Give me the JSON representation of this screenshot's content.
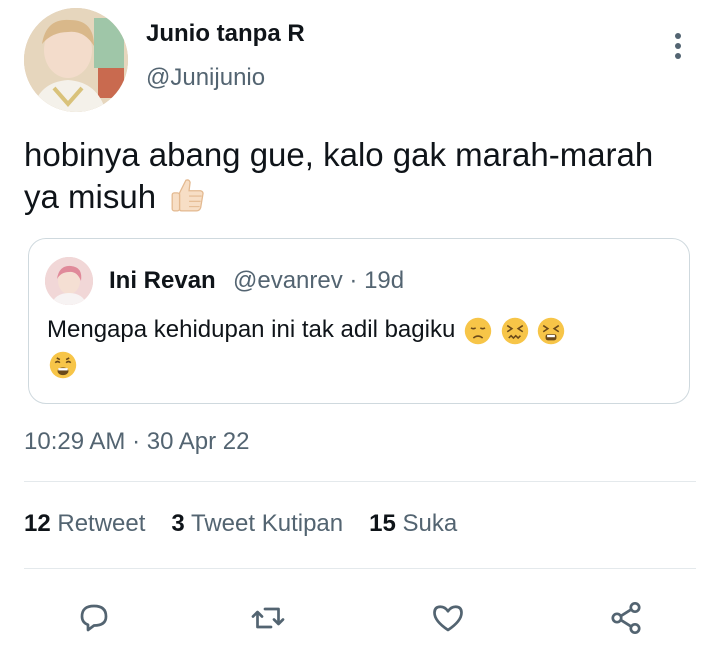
{
  "author": {
    "name": "Junio tanpa R",
    "handle": "@Junijunio",
    "avatar_icon": "user-photo-avatar"
  },
  "tweet": {
    "text": "hobinya abang gue, kalo gak marah-marah ya misuh",
    "emoji": "thumbs-up-light-skin-tone"
  },
  "quote": {
    "name": "Ini Revan",
    "handle_time": "@evanrev · 19d",
    "text": "Mengapa kehidupan ini tak adil bagiku",
    "emojis": [
      "disappointed-face",
      "confounded-face",
      "tired-face",
      "weary-face"
    ]
  },
  "timestamp": "10:29 AM · 30 Apr 22",
  "stats": {
    "retweets_count": "12",
    "retweets_label": "Retweet",
    "quotes_count": "3",
    "quotes_label": "Tweet Kutipan",
    "likes_count": "15",
    "likes_label": "Suka"
  },
  "actions": [
    "reply-icon",
    "retweet-icon",
    "like-icon",
    "share-icon"
  ],
  "colors": {
    "text": "#0f1419",
    "secondary": "#536471",
    "border": "#cfd9de",
    "icon": "#536471"
  }
}
